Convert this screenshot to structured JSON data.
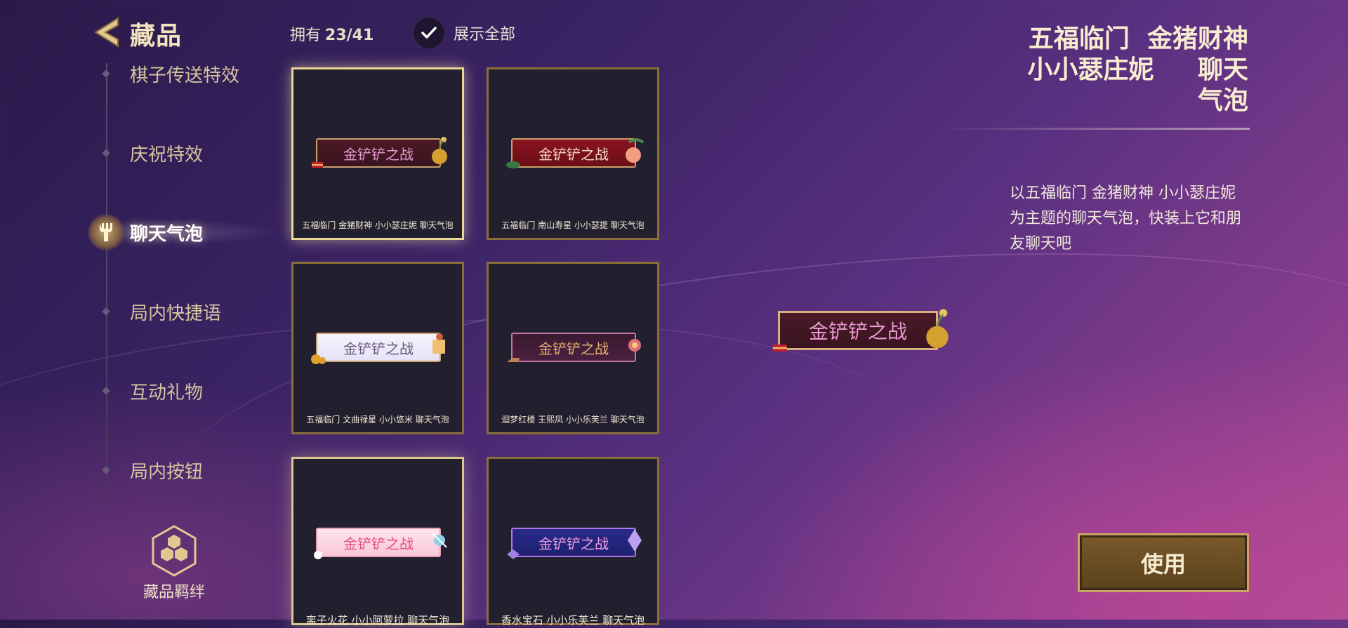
{
  "header": {
    "title": "藏品",
    "owned_label": "拥有",
    "owned_count": "23/41",
    "show_all_label": "展示全部",
    "show_all_checked": true
  },
  "sidebar": {
    "items": [
      {
        "label": "棋子传送特效",
        "active": false
      },
      {
        "label": "庆祝特效",
        "active": false
      },
      {
        "label": "聊天气泡",
        "active": true
      },
      {
        "label": "局内快捷语",
        "active": false
      },
      {
        "label": "互动礼物",
        "active": false
      },
      {
        "label": "局内按钮",
        "active": false
      }
    ],
    "bond_label": "藏品羁绊"
  },
  "grid": {
    "items": [
      {
        "bubble_text": "金铲铲之战",
        "caption": "五福临门  金猪财神  小小瑟庄妮    聊天气泡",
        "selected": true
      },
      {
        "bubble_text": "金铲铲之战",
        "caption": "五福临门  南山寿星  小小瑟提    聊天气泡",
        "selected": false
      },
      {
        "bubble_text": "金铲铲之战",
        "caption": "五福临门  文曲禄星  小小悠米    聊天气泡",
        "selected": false
      },
      {
        "bubble_text": "金铲铲之战",
        "caption": "迴梦红楼  王熙凤  小小乐芙兰  聊天气泡",
        "selected": false
      },
      {
        "bubble_text": "金铲铲之战",
        "caption": "离子火花  小小阿萝拉  聊天气泡",
        "selected": false
      },
      {
        "bubble_text": "金铲铲之战",
        "caption": "香水宝石  小小乐芙兰  聊天气泡",
        "selected": false
      }
    ]
  },
  "preview": {
    "bubble_text": "金铲铲之战"
  },
  "detail": {
    "title_line1": "五福临门  金猪财神",
    "title_line2": "小小瑟庄妮     聊天",
    "title_line3": "气泡",
    "description": "以五福临门 金猪财神 小小瑟庄妮为主题的聊天气泡，快装上它和朋友聊天吧",
    "use_button": "使用"
  },
  "colors": {
    "accent_gold": "#c9a466",
    "selected_border": "#e9d79a"
  }
}
